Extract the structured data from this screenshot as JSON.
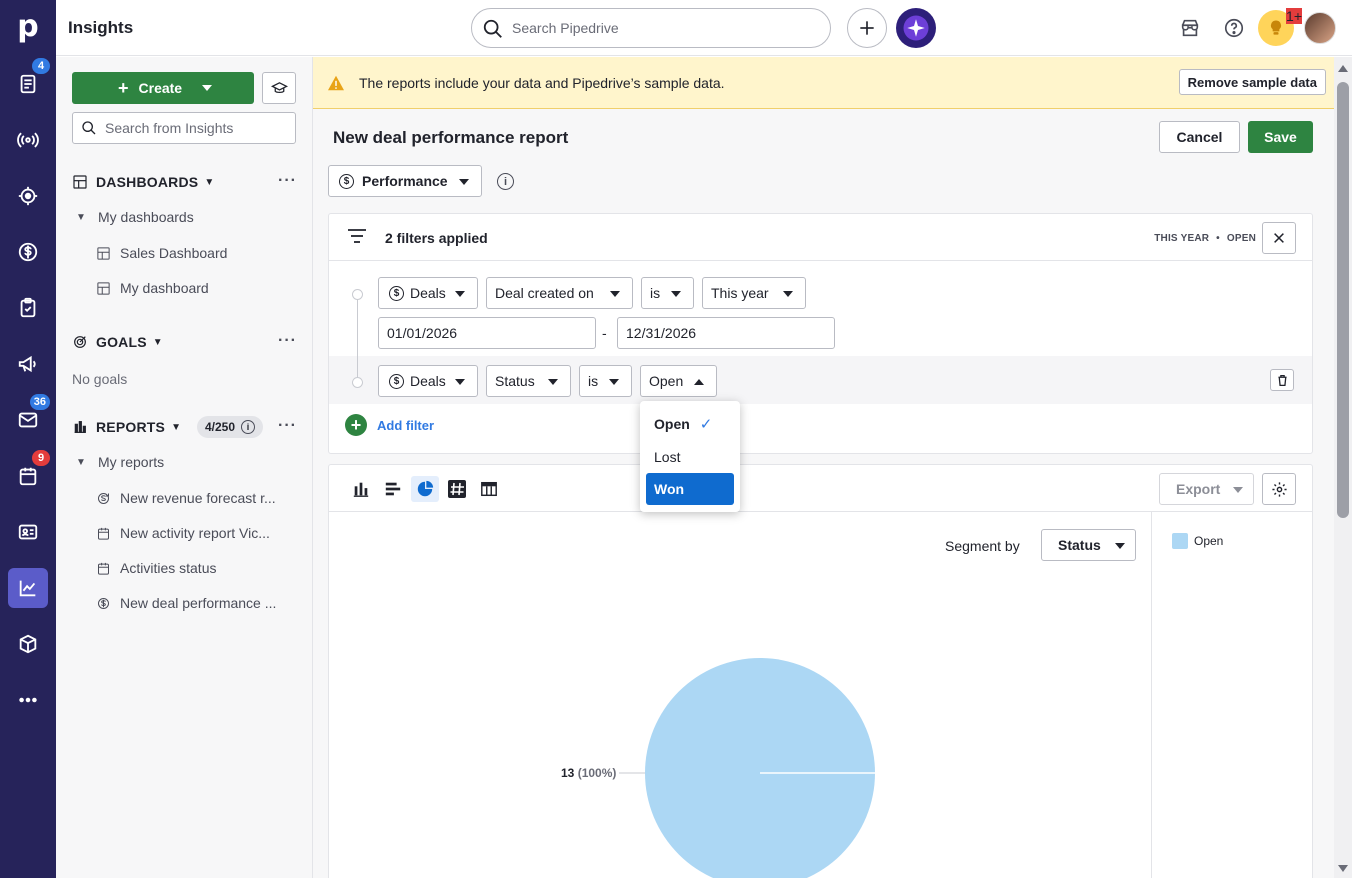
{
  "app": {
    "title": "Insights",
    "logo": "p"
  },
  "rail": {
    "items": [
      {
        "name": "leads-icon",
        "badge": "4"
      },
      {
        "name": "campaigns-radio-icon",
        "badge": ""
      },
      {
        "name": "target-icon",
        "badge": ""
      },
      {
        "name": "deals-dollar-icon",
        "badge": ""
      },
      {
        "name": "activities-clipboard-icon",
        "badge": ""
      },
      {
        "name": "megaphone-icon",
        "badge": ""
      },
      {
        "name": "mail-icon",
        "badge": "36"
      },
      {
        "name": "calendar-icon",
        "badge": "9"
      },
      {
        "name": "contacts-card-icon",
        "badge": ""
      },
      {
        "name": "insights-chart-icon",
        "badge": "",
        "active": true
      },
      {
        "name": "products-box-icon",
        "badge": ""
      },
      {
        "name": "more-icon",
        "badge": ""
      }
    ]
  },
  "topbar": {
    "search_placeholder": "Search Pipedrive",
    "notification_badge": "1+"
  },
  "sidebar": {
    "create_label": "Create",
    "search_placeholder": "Search from Insights",
    "dashboards": {
      "title": "DASHBOARDS",
      "group": "My dashboards",
      "items": [
        "Sales Dashboard",
        "My dashboard"
      ]
    },
    "goals": {
      "title": "GOALS",
      "empty": "No goals"
    },
    "reports": {
      "title": "REPORTS",
      "counter": "4/250",
      "group": "My reports",
      "items": [
        {
          "label": "New revenue forecast r...",
          "icon": "forecast-icon"
        },
        {
          "label": "New activity report Vic...",
          "icon": "calendar-icon"
        },
        {
          "label": "Activities status",
          "icon": "calendar-icon"
        },
        {
          "label": "New deal performance ...",
          "icon": "dollar-icon"
        }
      ]
    }
  },
  "banner": {
    "text": "The reports include your data and Pipedrive’s sample data.",
    "button": "Remove sample data"
  },
  "report": {
    "title": "New deal performance report",
    "cancel": "Cancel",
    "save": "Save",
    "type": "Performance"
  },
  "filters": {
    "summary": "2 filters applied",
    "tag1": "THIS YEAR",
    "tag_sep": "•",
    "tag2": "OPEN",
    "row1": {
      "entity": "Deals",
      "field": "Deal created on",
      "op": "is",
      "value": "This year",
      "from": "01/01/2026",
      "dash": "-",
      "to": "12/31/2026"
    },
    "row2": {
      "entity": "Deals",
      "field": "Status",
      "op": "is",
      "value": "Open"
    },
    "add": "Add filter"
  },
  "dropdown": {
    "options": [
      "Open",
      "Lost",
      "Won"
    ],
    "selected": "Open",
    "highlighted": "Won"
  },
  "chart_toolbar": {
    "export": "Export",
    "segment_label": "Segment by",
    "segment_value": "Status"
  },
  "chart_data": {
    "type": "pie",
    "slices": [
      {
        "label": "Open",
        "value": 13,
        "percent": "100%",
        "color": "#acd7f4"
      }
    ],
    "data_label": "13",
    "data_label_pct": "(100%)",
    "legend": [
      "Open"
    ],
    "legend_placement": "right"
  }
}
